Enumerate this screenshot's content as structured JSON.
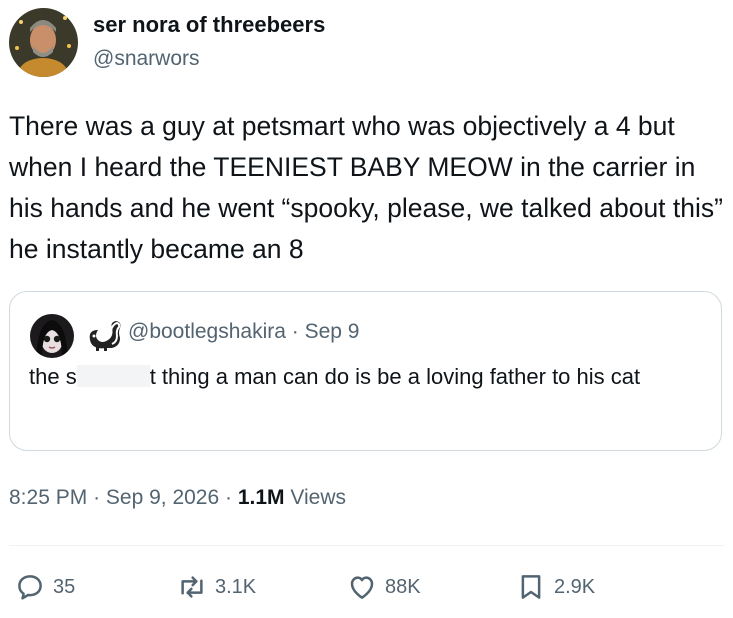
{
  "author": {
    "name": "ser nora of threebeers",
    "handle": "@snarwors"
  },
  "post": {
    "text": "There was a guy at petsmart who was objectively a 4 but when I heard the TEENIEST BABY MEOW in the carrier in his hands and he went “spooky, please, we talked about this” he instantly became an 8"
  },
  "quote": {
    "handle": "@bootlegshakira",
    "date": "Sep 9",
    "text_before": "the s",
    "text_after": "t thing a man can do is be a loving father to his cat"
  },
  "meta": {
    "time": "8:25 PM",
    "date": "Sep 9, 2026",
    "views_count": "1.1M",
    "views_label": "Views"
  },
  "actions": {
    "replies": "35",
    "reposts": "3.1K",
    "likes": "88K",
    "bookmarks": "2.9K"
  },
  "colors": {
    "text": "#0f1419",
    "secondary": "#536471",
    "border": "#cfd9de"
  },
  "icons": [
    "reply-icon",
    "repost-icon",
    "like-icon",
    "bookmark-icon",
    "skunk-icon"
  ]
}
